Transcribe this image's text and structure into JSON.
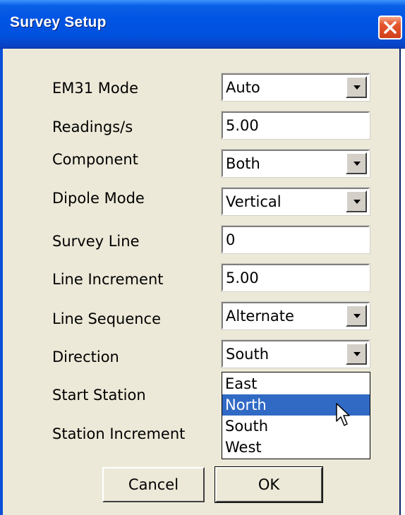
{
  "window": {
    "title": "Survey Setup"
  },
  "fields": [
    {
      "label": "EM31 Mode",
      "value": "Auto",
      "type": "dropdown"
    },
    {
      "label": "Readings/s",
      "value": "5.00",
      "type": "text"
    },
    {
      "label": "Component",
      "value": "Both",
      "type": "dropdown"
    },
    {
      "label": "Dipole Mode",
      "value": "Vertical",
      "type": "dropdown"
    },
    {
      "label": "Survey Line",
      "value": "0",
      "type": "text"
    },
    {
      "label": "Line Increment",
      "value": "5.00",
      "type": "text"
    },
    {
      "label": "Line Sequence",
      "value": "Alternate",
      "type": "dropdown"
    },
    {
      "label": "Direction",
      "value": "South",
      "type": "dropdown"
    },
    {
      "label": "Start Station"
    },
    {
      "label": "Station Increment"
    }
  ],
  "direction_dropdown": {
    "options": [
      "East",
      "North",
      "South",
      "West"
    ],
    "highlighted": "North"
  },
  "buttons": {
    "cancel": "Cancel",
    "ok": "OK"
  },
  "colors": {
    "titlebar": "#0054e3",
    "dialog_bg": "#ece9d8",
    "highlight": "#316ac5",
    "close_button": "#e4572e"
  },
  "icons": {
    "close": "close-icon",
    "dropdown": "chevron-down-icon",
    "cursor": "mouse-pointer-icon"
  }
}
